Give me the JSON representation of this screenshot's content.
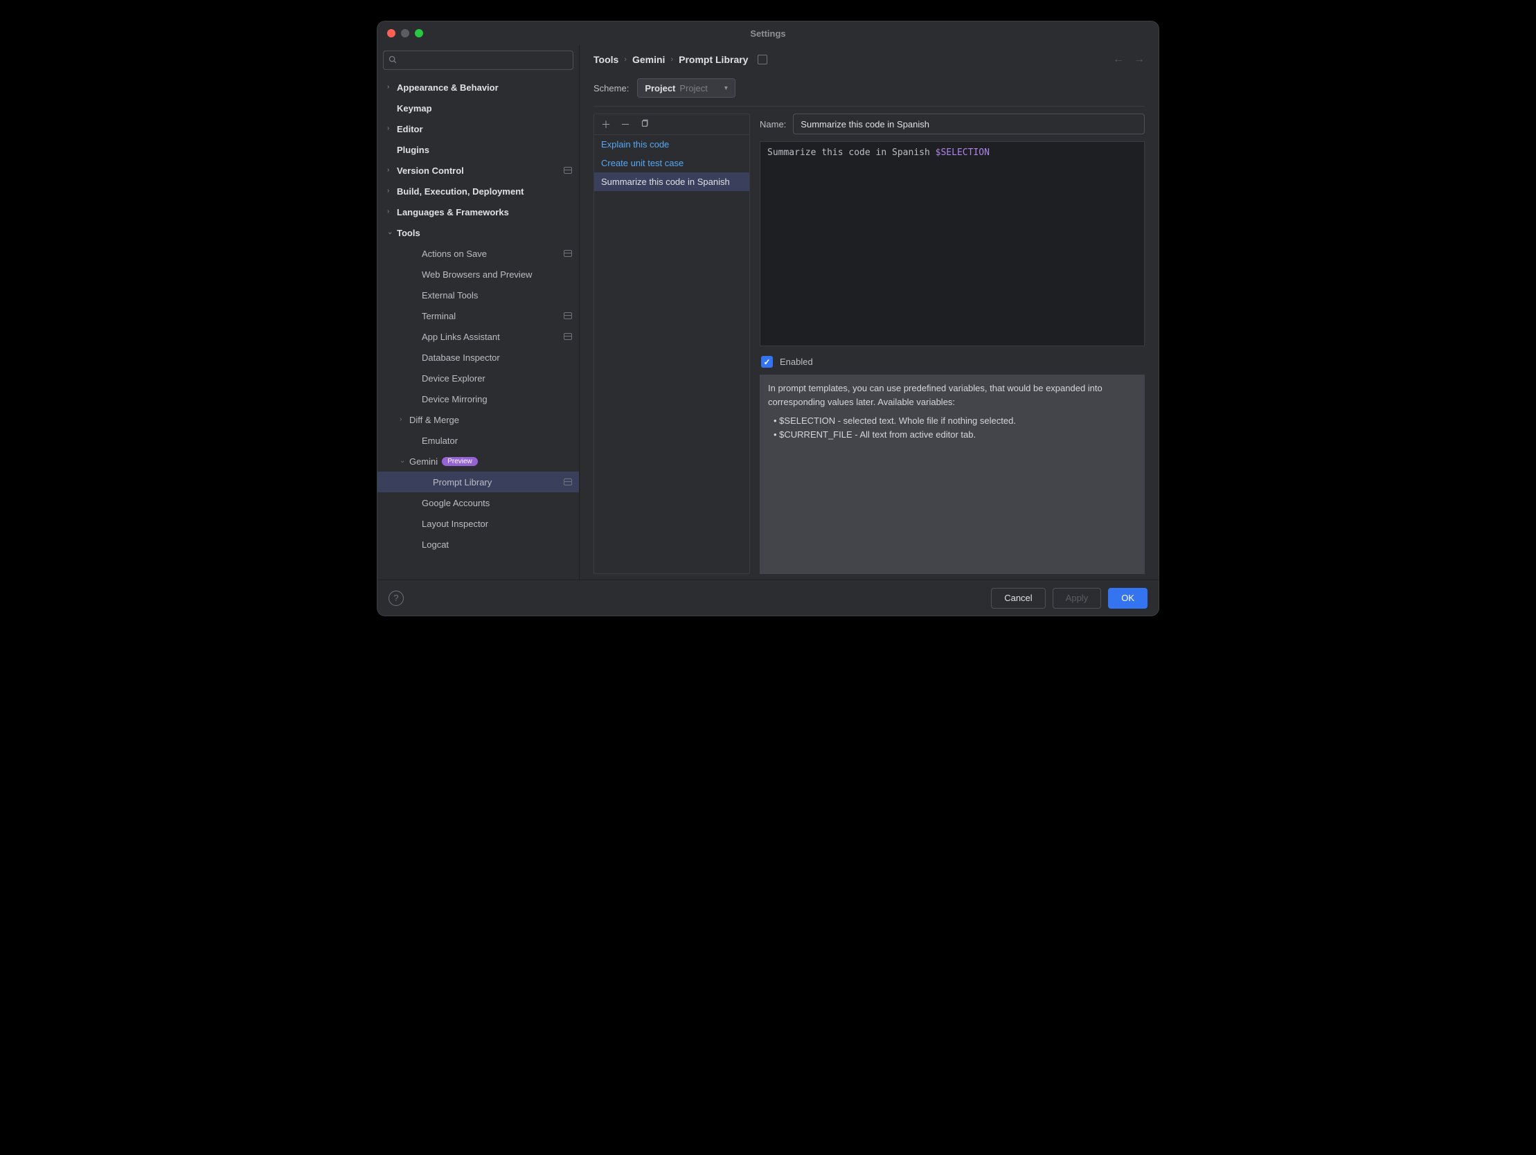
{
  "window": {
    "title": "Settings"
  },
  "colors": {
    "traffic_close": "#ff5f57",
    "traffic_min": "#5a5d63",
    "traffic_max": "#28c840"
  },
  "sidebar": {
    "search_placeholder": "",
    "items": [
      {
        "label": "Appearance & Behavior",
        "bold": true,
        "arrow": "right"
      },
      {
        "label": "Keymap",
        "bold": true,
        "arrow": "none"
      },
      {
        "label": "Editor",
        "bold": true,
        "arrow": "right"
      },
      {
        "label": "Plugins",
        "bold": true,
        "arrow": "none"
      },
      {
        "label": "Version Control",
        "bold": true,
        "arrow": "right",
        "proj": true
      },
      {
        "label": "Build, Execution, Deployment",
        "bold": true,
        "arrow": "right"
      },
      {
        "label": "Languages & Frameworks",
        "bold": true,
        "arrow": "right"
      },
      {
        "label": "Tools",
        "bold": true,
        "arrow": "down"
      },
      {
        "label": "Actions on Save",
        "sub": true,
        "proj": true
      },
      {
        "label": "Web Browsers and Preview",
        "sub": true
      },
      {
        "label": "External Tools",
        "sub": true
      },
      {
        "label": "Terminal",
        "sub": true,
        "proj": true
      },
      {
        "label": "App Links Assistant",
        "sub": true,
        "proj": true
      },
      {
        "label": "Database Inspector",
        "sub": true
      },
      {
        "label": "Device Explorer",
        "sub": true
      },
      {
        "label": "Device Mirroring",
        "sub": true
      },
      {
        "label": "Diff & Merge",
        "sub": true,
        "arrow": "right",
        "subArrow": true
      },
      {
        "label": "Emulator",
        "sub": true
      },
      {
        "label": "Gemini",
        "sub": true,
        "arrow": "down",
        "subArrow": true,
        "badge": "Preview"
      },
      {
        "label": "Prompt Library",
        "sub2": true,
        "selected": true,
        "proj": true
      },
      {
        "label": "Google Accounts",
        "sub": true
      },
      {
        "label": "Layout Inspector",
        "sub": true
      },
      {
        "label": "Logcat",
        "sub": true
      }
    ]
  },
  "breadcrumb": [
    "Tools",
    "Gemini",
    "Prompt Library"
  ],
  "scheme": {
    "label": "Scheme:",
    "value": "Project",
    "hint": "Project"
  },
  "prompts": {
    "items": [
      {
        "label": "Explain this code"
      },
      {
        "label": "Create unit test case"
      },
      {
        "label": "Summarize this code in Spanish",
        "selected": true
      }
    ]
  },
  "editor": {
    "name_label": "Name:",
    "name_value": "Summarize this code in Spanish",
    "body_plain": "Summarize this code in Spanish ",
    "body_var": "$SELECTION",
    "enabled_label": "Enabled",
    "enabled": true,
    "info_intro": "In prompt templates, you can use predefined variables, that would be expanded into corresponding values later. Available variables:",
    "info_b1": "• $SELECTION - selected text. Whole file if nothing selected.",
    "info_b2": "• $CURRENT_FILE - All text from active editor tab."
  },
  "footer": {
    "cancel": "Cancel",
    "apply": "Apply",
    "ok": "OK"
  }
}
